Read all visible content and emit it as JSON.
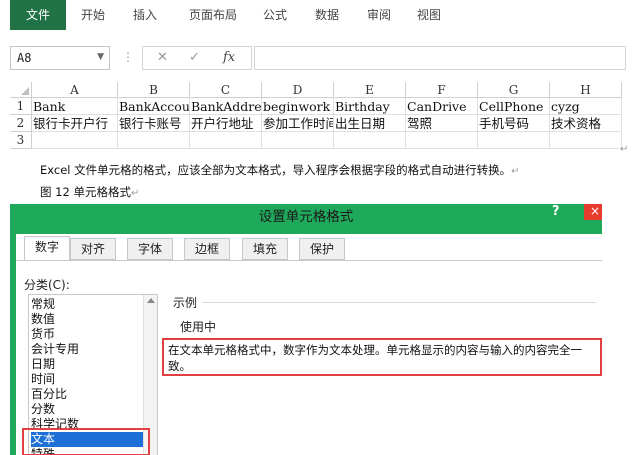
{
  "ribbon": {
    "tabs": [
      {
        "label": "文件",
        "active": true
      },
      {
        "label": "开始"
      },
      {
        "label": "插入"
      },
      {
        "label": "页面布局"
      },
      {
        "label": "公式"
      },
      {
        "label": "数据"
      },
      {
        "label": "审阅"
      },
      {
        "label": "视图"
      }
    ]
  },
  "formula_bar": {
    "name_box": "A8",
    "cancel_symbol": "✕",
    "enter_symbol": "✓",
    "fx_label": "fx",
    "formula": ""
  },
  "sheet": {
    "columns": [
      "A",
      "B",
      "C",
      "D",
      "E",
      "F",
      "G",
      "H"
    ],
    "rows": [
      {
        "num": "1",
        "cells": [
          "Bank",
          "BankAccou",
          "BankAddre",
          "beginwork",
          "Birthday",
          "CanDrive",
          "CellPhone",
          "cyzg"
        ]
      },
      {
        "num": "2",
        "cells": [
          "银行卡开户行",
          "银行卡账号",
          "开户行地址",
          "参加工作时间",
          "出生日期",
          "驾照",
          "手机号码",
          "技术资格"
        ]
      },
      {
        "num": "3",
        "cells": [
          "",
          "",
          "",
          "",
          "",
          "",
          "",
          ""
        ]
      }
    ]
  },
  "document": {
    "paragraph": "Excel 文件单元格的格式，应该全部为文本格式，导入程序会根据字段的格式自动进行转换。",
    "caption": "图 12 单元格格式",
    "paragraph_mark": "↵"
  },
  "dialog": {
    "title": "设置单元格格式",
    "help": "?",
    "close": "×",
    "tabs": [
      {
        "label": "数字",
        "active": true
      },
      {
        "label": "对齐"
      },
      {
        "label": "字体"
      },
      {
        "label": "边框"
      },
      {
        "label": "填充"
      },
      {
        "label": "保护"
      }
    ],
    "category_label": "分类(C):",
    "categories": [
      {
        "label": "常规"
      },
      {
        "label": "数值"
      },
      {
        "label": "货币"
      },
      {
        "label": "会计专用"
      },
      {
        "label": "日期"
      },
      {
        "label": "时间"
      },
      {
        "label": "百分比"
      },
      {
        "label": "分数"
      },
      {
        "label": "科学记数"
      },
      {
        "label": "文本",
        "selected": true
      },
      {
        "label": "特殊"
      }
    ],
    "sample_label": "示例",
    "sample_value": "使用中",
    "description": "在文本单元格格式中，数字作为文本处理。单元格显示的内容与输入的内容完全一致。"
  },
  "colors": {
    "excel_green": "#217346",
    "dialog_green": "#1fa95a",
    "highlight_red": "#e04040",
    "selection_blue": "#1e6fd6"
  }
}
